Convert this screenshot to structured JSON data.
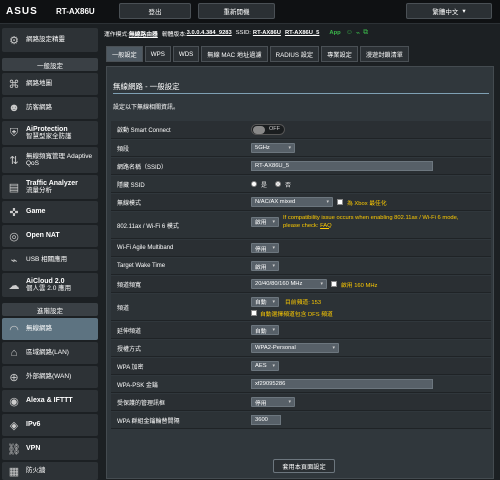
{
  "header": {
    "logo": "ASUS",
    "model": "RT-AX86U",
    "logout_label": "登出",
    "reboot_label": "重新開機",
    "language": "繁體中文"
  },
  "statusbar": {
    "mode_label": "運作模式:",
    "mode_value": "無線路由器",
    "fw_label": "韌體版本:",
    "fw_value": "3.0.0.4.384_9283",
    "ssid_label": "SSID:",
    "ssid1": "RT-AX86U",
    "ssid2": "RT-AX86U_5",
    "app_label": "App"
  },
  "sidebar": {
    "quick": "網路設定精靈",
    "general_head": "一般設定",
    "items": [
      {
        "label": "網路地圖",
        "sub": ""
      },
      {
        "label": "訪客網路",
        "sub": ""
      },
      {
        "label": "AiProtection",
        "sub": "智慧型家全防護"
      },
      {
        "label": "無線頻寬管理 Adaptive",
        "sub": "QoS"
      },
      {
        "label": "Traffic Analyzer",
        "sub": "流量分析"
      },
      {
        "label": "Game",
        "sub": ""
      },
      {
        "label": "Open NAT",
        "sub": ""
      },
      {
        "label": "USB 相關應用",
        "sub": ""
      },
      {
        "label": "AiCloud 2.0",
        "sub": "個人雲 2.0 應用"
      }
    ],
    "advanced_head": "進階設定",
    "adv_items": [
      {
        "label": "無線網路"
      },
      {
        "label": "區域網路(LAN)"
      },
      {
        "label": "外部網路(WAN)"
      },
      {
        "label": "Alexa & IFTTT"
      },
      {
        "label": "IPv6"
      },
      {
        "label": "VPN"
      },
      {
        "label": "防火牆"
      }
    ]
  },
  "tabs": [
    "一般設定",
    "WPS",
    "WDS",
    "無線 MAC 地址過濾",
    "RADIUS 設定",
    "專業設定",
    "漫遊封鎖清單"
  ],
  "panel": {
    "title": "無線網路 - 一般設定",
    "desc": "設定以下無線相關資訊。",
    "rows": {
      "smart_connect": {
        "label": "啟動 Smart Connect",
        "value": "OFF"
      },
      "band": {
        "label": "頻段",
        "value": "5GHz"
      },
      "ssid": {
        "label": "網路名稱（SSID）",
        "value": "RT-AX86U_5"
      },
      "hide_ssid": {
        "label": "隱藏 SSID",
        "yes": "是",
        "no": "否"
      },
      "wireless_mode": {
        "label": "無線模式",
        "value": "N/AC/AX mixed",
        "xbox": "為 Xbox 最佳化"
      },
      "ax_mode": {
        "label": "802.11ax / Wi-Fi 6 模式",
        "value": "啟用",
        "warn": "If compatibility issue occurs when enabling 802.11ax / Wi-Fi 6 mode, please check:",
        "faq": "FAQ"
      },
      "multiband": {
        "label": "Wi-Fi Agile Multiband",
        "value": "停用"
      },
      "twt": {
        "label": "Target Wake Time",
        "value": "啟用"
      },
      "bandwidth": {
        "label": "頻道頻寬",
        "value": "20/40/80/160 MHz",
        "cb": "啟用 160 MHz"
      },
      "channel": {
        "label": "頻道",
        "value": "自動",
        "current": "目前頻道: 153",
        "dfs": "自動選擇頻道包含 DFS 頻道"
      },
      "ext_channel": {
        "label": "延伸頻道",
        "value": "自動"
      },
      "auth": {
        "label": "授權方式",
        "value": "WPA2-Personal"
      },
      "wpa_enc": {
        "label": "WPA 加密",
        "value": "AES"
      },
      "psk": {
        "label": "WPA-PSK 金鑰",
        "value": "xf29095286"
      },
      "pmf": {
        "label": "受保護的管理訊框",
        "value": "停用"
      },
      "rekey": {
        "label": "WPA 群組金鑰輪替間隔",
        "value": "3600"
      }
    },
    "apply_label": "套用本頁面設定"
  }
}
